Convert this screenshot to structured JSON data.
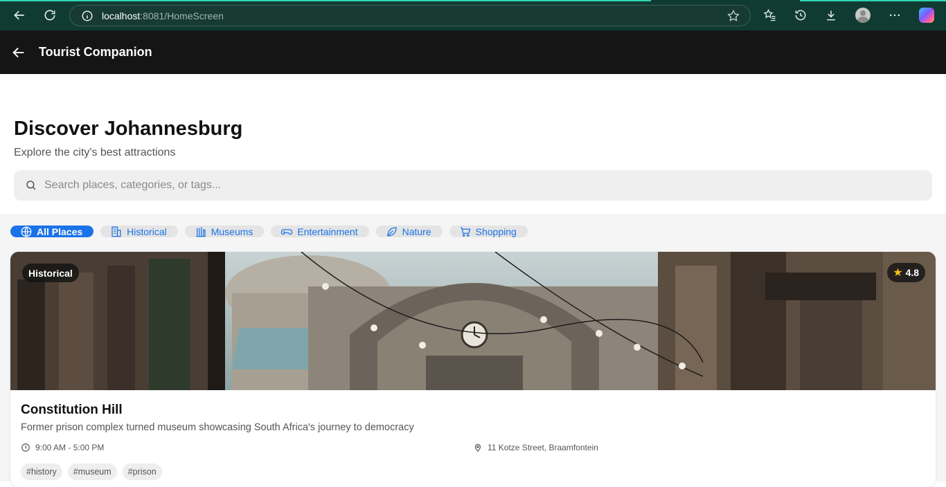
{
  "browser": {
    "url_host": "localhost",
    "url_rest": ":8081/HomeScreen"
  },
  "app": {
    "title": "Tourist Companion"
  },
  "hero": {
    "title": "Discover Johannesburg",
    "subtitle": "Explore the city's best attractions"
  },
  "search": {
    "placeholder": "Search places, categories, or tags..."
  },
  "categories": [
    {
      "label": "All Places",
      "icon": "globe-icon",
      "active": true
    },
    {
      "label": "Historical",
      "icon": "building-icon",
      "active": false
    },
    {
      "label": "Museums",
      "icon": "library-icon",
      "active": false
    },
    {
      "label": "Entertainment",
      "icon": "gamepad-icon",
      "active": false
    },
    {
      "label": "Nature",
      "icon": "leaf-icon",
      "active": false
    },
    {
      "label": "Shopping",
      "icon": "cart-icon",
      "active": false
    }
  ],
  "place": {
    "category": "Historical",
    "rating": "4.8",
    "name": "Constitution Hill",
    "description": "Former prison complex turned museum showcasing South Africa's journey to democracy",
    "hours": "9:00 AM - 5:00 PM",
    "address": "11 Kotze Street, Braamfontein",
    "tags": [
      "#history",
      "#museum",
      "#prison"
    ]
  },
  "colors": {
    "accent": "#1a73e8",
    "header_bg": "#151515",
    "browser_bg": "#0f3b32",
    "rating_star": "#f6c218"
  }
}
